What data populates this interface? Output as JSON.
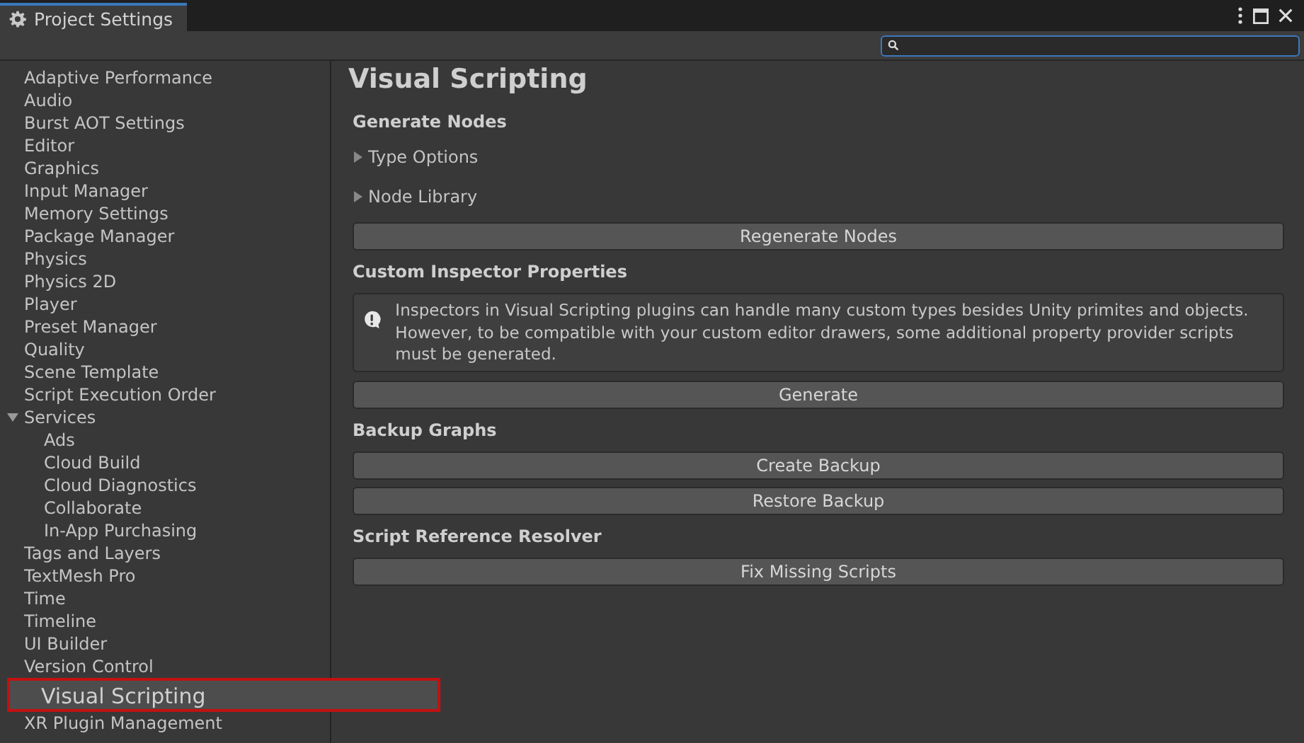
{
  "window": {
    "tab_title": "Project Settings"
  },
  "sidebar": {
    "items": [
      {
        "label": "Adaptive Performance",
        "selected": false
      },
      {
        "label": "Audio",
        "selected": false
      },
      {
        "label": "Burst AOT Settings",
        "selected": false
      },
      {
        "label": "Editor",
        "selected": false
      },
      {
        "label": "Graphics",
        "selected": false
      },
      {
        "label": "Input Manager",
        "selected": false
      },
      {
        "label": "Memory Settings",
        "selected": false
      },
      {
        "label": "Package Manager",
        "selected": false
      },
      {
        "label": "Physics",
        "selected": false
      },
      {
        "label": "Physics 2D",
        "selected": false
      },
      {
        "label": "Player",
        "selected": false
      },
      {
        "label": "Preset Manager",
        "selected": false
      },
      {
        "label": "Quality",
        "selected": false
      },
      {
        "label": "Scene Template",
        "selected": false
      },
      {
        "label": "Script Execution Order",
        "selected": false
      },
      {
        "label": "Services",
        "selected": false,
        "expanded": true,
        "children": [
          {
            "label": "Ads",
            "selected": false
          },
          {
            "label": "Cloud Build",
            "selected": false
          },
          {
            "label": "Cloud Diagnostics",
            "selected": false
          },
          {
            "label": "Collaborate",
            "selected": false
          },
          {
            "label": "In-App Purchasing",
            "selected": false
          }
        ]
      },
      {
        "label": "Tags and Layers",
        "selected": false
      },
      {
        "label": "TextMesh Pro",
        "selected": false
      },
      {
        "label": "Time",
        "selected": false
      },
      {
        "label": "Timeline",
        "selected": false
      },
      {
        "label": "UI Builder",
        "selected": false
      },
      {
        "label": "Version Control",
        "selected": false
      },
      {
        "label": "Visual Scripting",
        "selected": true
      },
      {
        "label": "XR Plugin Management",
        "selected": false
      }
    ]
  },
  "content": {
    "title": "Visual Scripting",
    "sections": [
      {
        "heading": "Generate Nodes",
        "items": [
          {
            "kind": "foldout",
            "label": "Type Options",
            "expanded": false
          },
          {
            "kind": "foldout",
            "label": "Node Library",
            "expanded": false
          },
          {
            "kind": "button",
            "label": "Regenerate Nodes"
          }
        ]
      },
      {
        "heading": "Custom Inspector Properties",
        "items": [
          {
            "kind": "warning",
            "text": "Inspectors in Visual Scripting plugins can handle many custom types besides Unity primites and objects. However, to be compatible with your custom editor drawers, some additional property provider scripts must be generated."
          },
          {
            "kind": "button",
            "label": "Generate"
          }
        ]
      },
      {
        "heading": "Backup Graphs",
        "items": [
          {
            "kind": "button",
            "label": "Create Backup"
          },
          {
            "kind": "button",
            "label": "Restore Backup"
          }
        ]
      },
      {
        "heading": "Script Reference Resolver",
        "items": [
          {
            "kind": "button",
            "label": "Fix Missing Scripts"
          }
        ]
      }
    ]
  }
}
